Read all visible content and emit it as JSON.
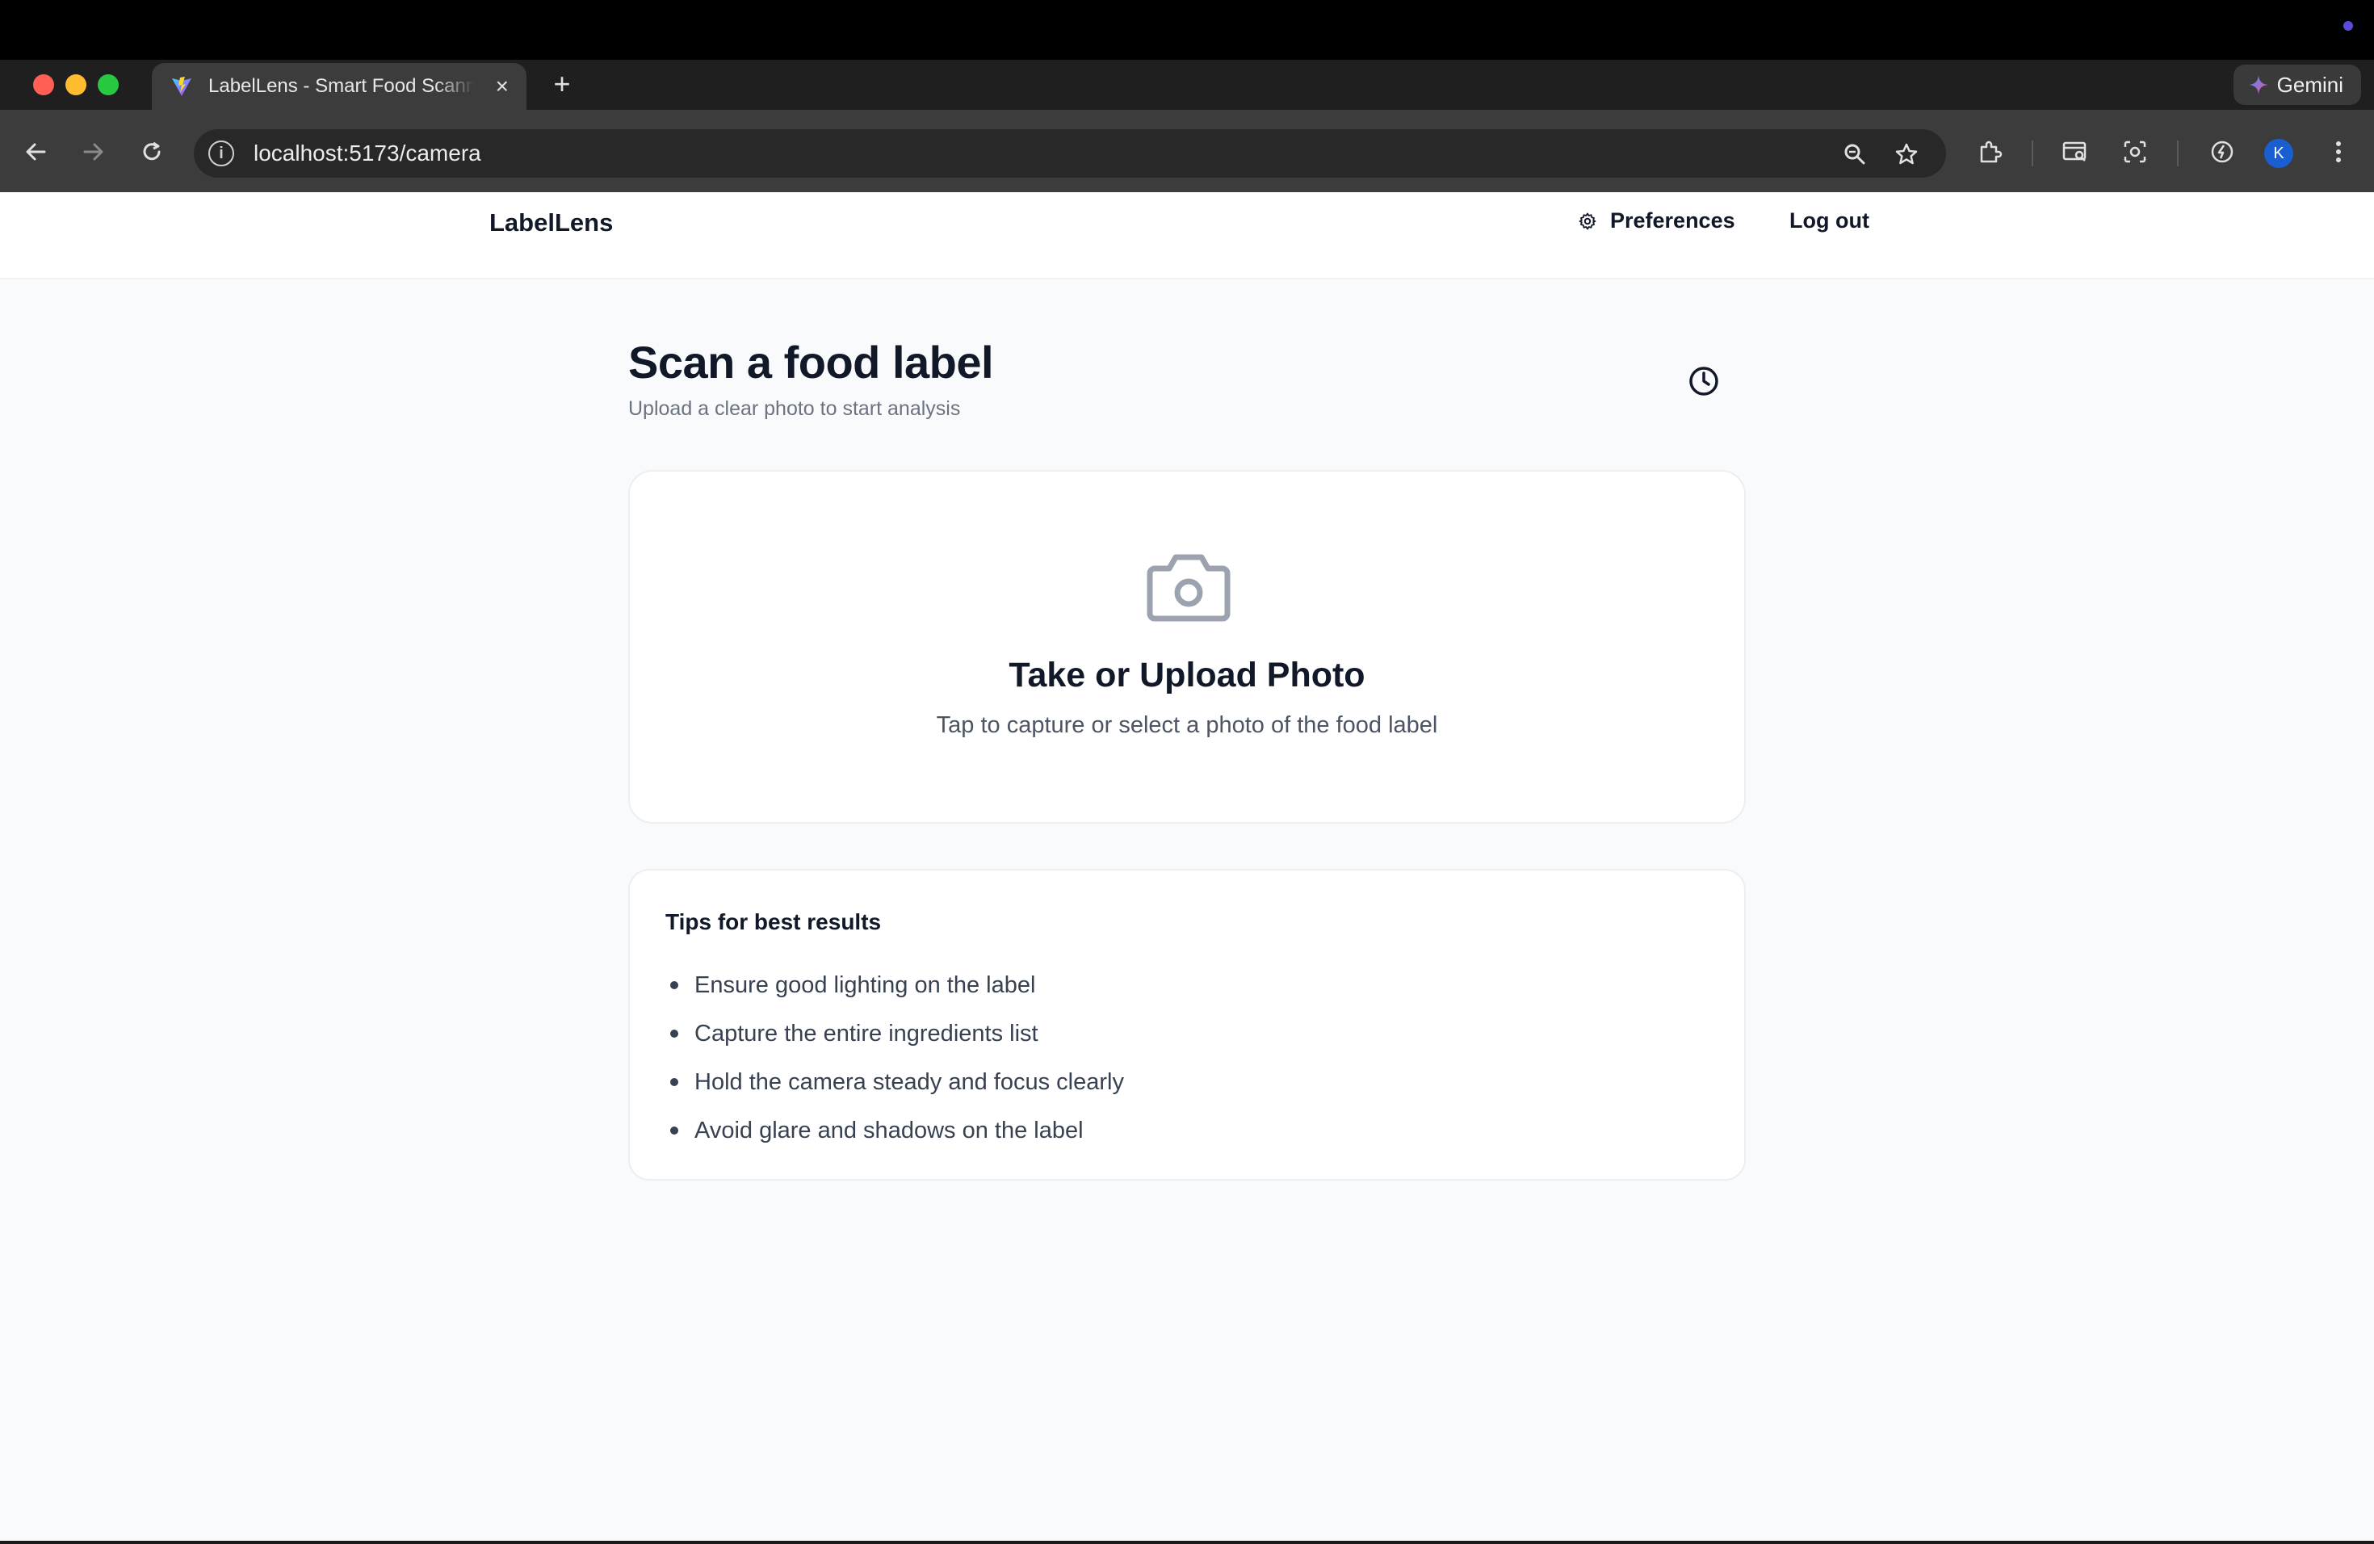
{
  "browser": {
    "tab_title": "LabelLens - Smart Food Scanner",
    "tab_close": "×",
    "new_tab": "+",
    "gemini_label": "Gemini",
    "url": "localhost:5173/camera",
    "profile_initial": "K"
  },
  "header": {
    "brand": "LabelLens",
    "preferences_label": "Preferences",
    "logout_label": "Log out"
  },
  "main": {
    "title": "Scan a food label",
    "subtitle": "Upload a clear photo to start analysis",
    "upload": {
      "title": "Take or Upload Photo",
      "description": "Tap to capture or select a photo of the food label"
    },
    "tips": {
      "title": "Tips for best results",
      "items": [
        "Ensure good lighting on the label",
        "Capture the entire ingredients list",
        "Hold the camera steady and focus clearly",
        "Avoid glare and shadows on the label"
      ]
    }
  },
  "colors": {
    "page_bg": "#f9fafb",
    "text_primary": "#111827",
    "text_muted": "#6b7280",
    "icon_gray": "#9ca3af"
  },
  "icons": {
    "history": "clock-icon",
    "upload": "camera-icon",
    "preferences": "gear-icon"
  }
}
